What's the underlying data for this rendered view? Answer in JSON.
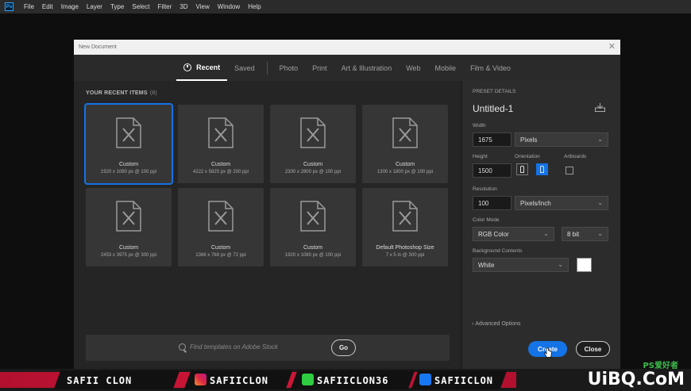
{
  "menubar": {
    "logo": "Ps",
    "items": [
      "File",
      "Edit",
      "Image",
      "Layer",
      "Type",
      "Select",
      "Filter",
      "3D",
      "View",
      "Window",
      "Help"
    ]
  },
  "dialog": {
    "title": "New Document",
    "close_glyph": "✕",
    "tabs": [
      "Recent",
      "Saved",
      "Photo",
      "Print",
      "Art & Illustration",
      "Web",
      "Mobile",
      "Film & Video"
    ],
    "active_tab": "Recent"
  },
  "recent": {
    "heading": "YOUR RECENT ITEMS",
    "count": "(8)",
    "items": [
      {
        "name": "Custom",
        "size": "1920 x 1080 px @ 100 ppi",
        "icon": "document-icon"
      },
      {
        "name": "Custom",
        "size": "4222 x 5825 px @ 200 ppi",
        "icon": "document-icon"
      },
      {
        "name": "Custom",
        "size": "2300 x 2800 px @ 100 ppi",
        "icon": "document-icon"
      },
      {
        "name": "Custom",
        "size": "1300 x 1800 px @ 100 ppi",
        "icon": "document-icon"
      },
      {
        "name": "Custom",
        "size": "2453 x 3975 px @ 300 ppi",
        "icon": "document-icon"
      },
      {
        "name": "Custom",
        "size": "1366 x 768 px @ 72 ppi",
        "icon": "document-icon"
      },
      {
        "name": "Custom",
        "size": "1920 x 1080 px @ 100 ppi",
        "icon": "document-icon"
      },
      {
        "name": "Default Photoshop Size",
        "size": "7 x 5 in @ 300 ppi",
        "icon": "document-icon"
      }
    ]
  },
  "search": {
    "placeholder": "Find templates on Adobe Stock",
    "go_label": "Go"
  },
  "preset": {
    "heading": "PRESET DETAILS",
    "doc_name": "Untitled-1",
    "width_label": "Width",
    "width_value": "1675",
    "width_unit": "Pixels",
    "height_label": "Height",
    "height_value": "1500",
    "orientation_label": "Orientation",
    "artboards_label": "Artboards",
    "resolution_label": "Resolution",
    "resolution_value": "100",
    "resolution_unit": "Pixels/Inch",
    "color_mode_label": "Color Mode",
    "color_mode_value": "RGB Color",
    "bit_depth": "8 bit",
    "background_label": "Background Contents",
    "background_value": "White",
    "advanced_label": "Advanced Options"
  },
  "actions": {
    "create_label": "Create",
    "close_label": "Close"
  },
  "banner": {
    "name": "SAFII CLON",
    "instagram": "SAFIICLON",
    "tiktok": "SAFIICLON36",
    "facebook": "SAFIICLON"
  },
  "watermark": {
    "text": "UiBQ.CoM",
    "sub": "PS爱好者"
  },
  "colors": {
    "accent": "#1473e6",
    "banner_red": "#d01638"
  }
}
